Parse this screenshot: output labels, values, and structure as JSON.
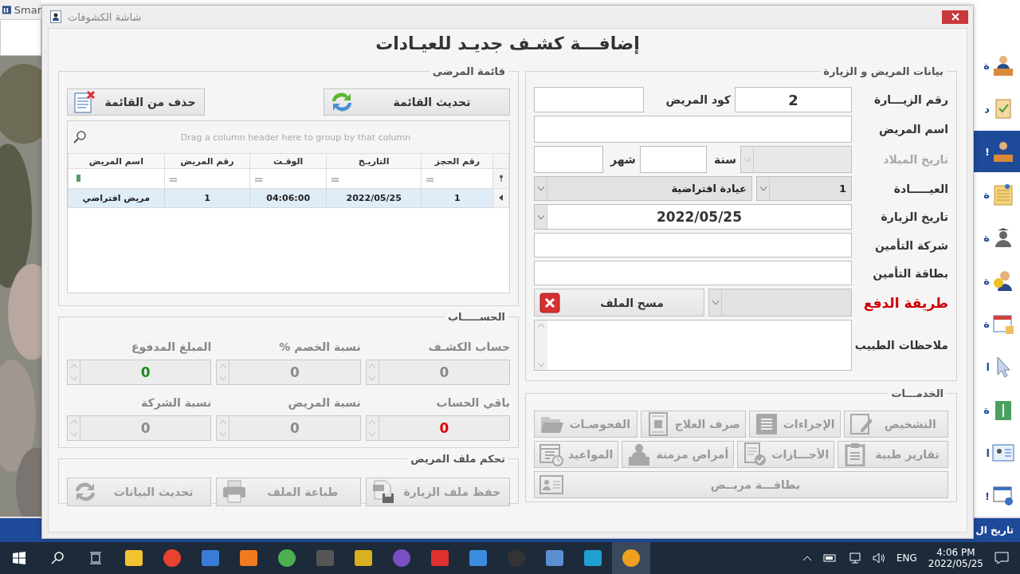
{
  "background_app": {
    "title": "Smar",
    "status_text": "تاريخ ال",
    "sidebar": [
      {
        "label": "ة",
        "selected": false
      },
      {
        "label": "د",
        "selected": false
      },
      {
        "label": "!",
        "selected": true
      },
      {
        "label": "ة",
        "selected": false
      },
      {
        "label": "ة",
        "selected": false
      },
      {
        "label": "ة",
        "selected": false
      },
      {
        "label": "ة",
        "selected": false
      },
      {
        "label": "ا",
        "selected": false
      },
      {
        "label": "ة",
        "selected": false
      },
      {
        "label": "ا",
        "selected": false
      },
      {
        "label": "!",
        "selected": false
      }
    ]
  },
  "dialog": {
    "title": "شاشة الكشوفات",
    "heading": "إضافـــة كشـف جديـد للعيـادات",
    "patients_list": {
      "title": "قائمة المرضى",
      "refresh_button": "تحديث القائمة",
      "delete_button": "حذف من القائمة",
      "group_panel": "Drag a column header here to group by that column",
      "columns": [
        "رقم الحجز",
        "التاريـخ",
        "الوقـت",
        "رقم المريض",
        "اسم المريض"
      ],
      "rows": [
        {
          "cells": [
            "1",
            "2022/05/25",
            "04:06:00",
            "1",
            "مريض افتراضي"
          ],
          "selected": true
        }
      ]
    },
    "account": {
      "title": "الحســـــاب",
      "fields": [
        {
          "label": "حساب الكشـف",
          "value": "0",
          "color": "#8a8a8a"
        },
        {
          "label": "نسبة الخصم  %",
          "value": "0",
          "color": "#8a8a8a"
        },
        {
          "label": "المبلغ المدفوع",
          "value": "0",
          "color": "#1f8a1f"
        },
        {
          "label": "باقي الحساب",
          "value": "0",
          "color": "#e00000"
        },
        {
          "label": "نسبة المريض",
          "value": "0",
          "color": "#8a8a8a"
        },
        {
          "label": "نسبة الشركة",
          "value": "0",
          "color": "#8a8a8a"
        }
      ]
    },
    "file_control": {
      "title": "تحكم ملف المريض",
      "buttons": [
        {
          "label": "حفظ ملف الزيارة",
          "disabled": true
        },
        {
          "label": "طباعة الملف",
          "disabled": true
        },
        {
          "label": "تحديث البيانات",
          "disabled": true
        }
      ]
    },
    "patient_visit": {
      "title": "بيانات المريض و الزيارة",
      "visit_no": {
        "label": "رقم الزيـــارة",
        "value": "2"
      },
      "patient_code": {
        "label": "كود المريض"
      },
      "patient_name": {
        "label": "اسم المريض"
      },
      "birth_date": {
        "label": "تاريخ الميلاد",
        "disabled": true
      },
      "year": {
        "label": "سنة"
      },
      "month": {
        "label": "شهر"
      },
      "clinic": {
        "label": "العيـــــادة",
        "number": "1",
        "name": "عيادة افتراضية"
      },
      "visit_date": {
        "label": "تاريخ الزيارة",
        "value": "2022/05/25"
      },
      "insurance_company": {
        "label": "شركة التأمين"
      },
      "insurance_card": {
        "label": "بطاقة التأمين"
      },
      "payment_method": {
        "label": "طريقة الدفع"
      },
      "clear_button": "مسح الملف",
      "doctor_notes": {
        "label": "ملاحظات الطبيب"
      }
    },
    "services": {
      "title": "الخدمـــات",
      "rows": [
        [
          {
            "label": "التشخيص",
            "disabled": true
          },
          {
            "label": "الإجراءات",
            "disabled": true
          },
          {
            "label": "صرف العلاج",
            "disabled": true
          },
          {
            "label": "الفحوصـات",
            "disabled": true
          }
        ],
        [
          {
            "label": "تقارير طبية",
            "disabled": true
          },
          {
            "label": "الأجـــازات",
            "disabled": true
          },
          {
            "label": "أمراض مزمنة",
            "disabled": true
          },
          {
            "label": "المواعيد",
            "disabled": true
          }
        ],
        [
          {
            "label": "بطاقـــة مريــض",
            "disabled": true
          }
        ]
      ]
    }
  },
  "taskbar": {
    "apps": [
      {
        "selected": false
      },
      {
        "selected": false
      },
      {
        "selected": false
      },
      {
        "selected": false
      },
      {
        "selected": false
      },
      {
        "selected": false
      },
      {
        "selected": false
      },
      {
        "selected": false
      },
      {
        "selected": false
      },
      {
        "selected": false
      },
      {
        "selected": false
      },
      {
        "selected": false
      },
      {
        "selected": false
      },
      {
        "selected": true
      }
    ],
    "language": "ENG",
    "time": "4:06 PM",
    "date": "2022/05/25"
  }
}
